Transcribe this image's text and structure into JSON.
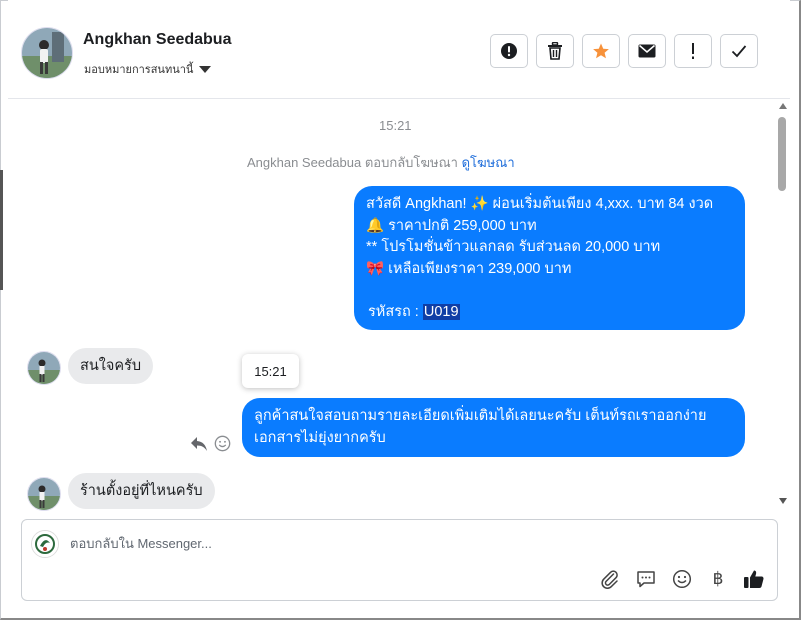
{
  "contact": {
    "name": "Angkhan Seedabua",
    "assign_label": "มอบหมายการสนทนานี้"
  },
  "actions": [
    {
      "icon": "alert-circle-icon",
      "label": "Mark as spam"
    },
    {
      "icon": "trash-icon",
      "label": "Delete"
    },
    {
      "icon": "star-icon",
      "label": "Star"
    },
    {
      "icon": "envelope-icon",
      "label": "Mark as unread"
    },
    {
      "icon": "exclamation-icon",
      "label": "Follow up"
    },
    {
      "icon": "check-icon",
      "label": "Mark as done"
    }
  ],
  "chat": {
    "timestamp_top": "15:21",
    "system_message": {
      "text": "Angkhan Seedabua ตอบกลับโฆษณา",
      "link": "ดูโฆษณา"
    },
    "ad_message": {
      "line1": "สวัสดี Angkhan! ✨ ผ่อนเริ่มต้นเพียง 4,xxx. บาท 84 งวด",
      "line2": "🔔 ราคาปกติ 259,000 บาท",
      "line3": "** โปรโมชั่นข้าวแลกลด รับส่วนลด 20,000 บาท",
      "line4": "🎀 เหลือเพียงราคา 239,000 บาท",
      "code_label": "รหัสรถ : ",
      "code_value": "U019"
    },
    "incoming_1": "สนใจครับ",
    "tooltip_time": "15:21",
    "outgoing_2": {
      "line1": "ลูกค้าสนใจสอบถามรายละเอียดเพิ่มเติมได้เลยนะครับ เต็นท์รถเราออกง่าย",
      "line2": "เอกสารไม่ยุ่งยากครับ"
    },
    "incoming_2": "ร้านตั้งอยู่ที่ไหนครับ"
  },
  "composer": {
    "placeholder": "ตอบกลับใน Messenger...",
    "tools": [
      "paperclip-icon",
      "chat-bubble-icon",
      "smiley-icon",
      "baht-icon",
      "thumbs-up-icon"
    ],
    "currency_symbol": "฿"
  },
  "colors": {
    "bubble_out": "#0a7cff",
    "bubble_in": "#e9eaec",
    "link": "#216fdb",
    "star": "#f7923b"
  }
}
